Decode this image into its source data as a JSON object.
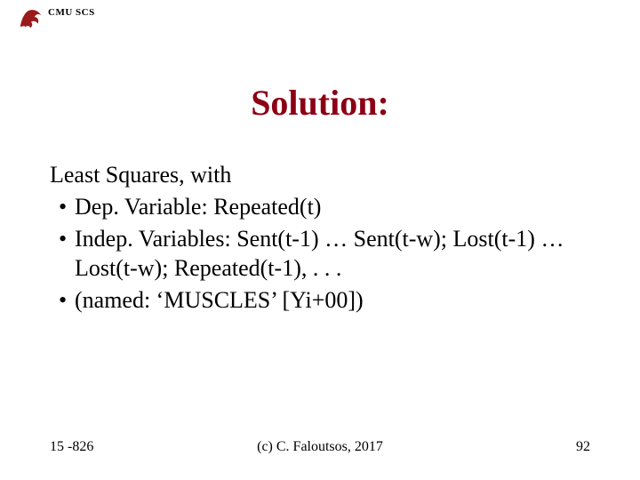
{
  "header": {
    "org_label": "CMU SCS"
  },
  "title": "Solution:",
  "body": {
    "lead": "Least Squares, with",
    "bullets": [
      "Dep. Variable: Repeated(t)",
      "Indep. Variables: Sent(t-1) … Sent(t-w); Lost(t-1) …Lost(t-w); Repeated(t-1), . . .",
      "(named: ‘MUSCLES’ [Yi+00])"
    ]
  },
  "footer": {
    "course": "15 -826",
    "copyright": "(c) C. Faloutsos, 2017",
    "page": "92"
  }
}
